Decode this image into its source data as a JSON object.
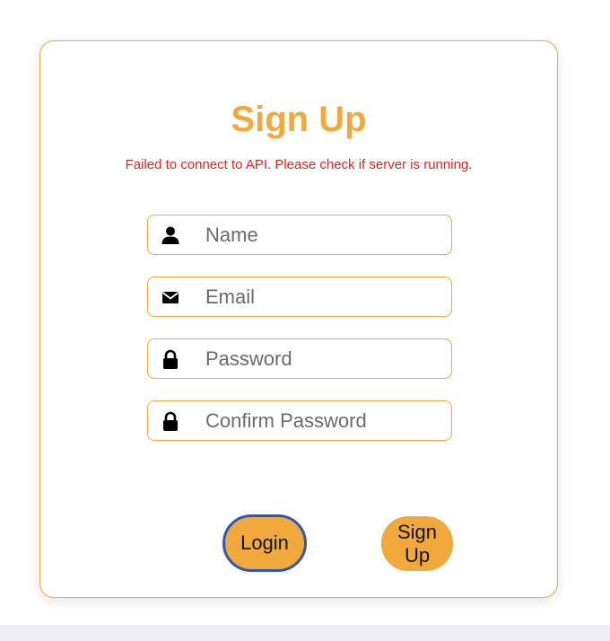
{
  "form": {
    "title": "Sign Up",
    "error_message": "Failed to connect to API. Please check if server is running.",
    "fields": [
      {
        "icon": "user-icon",
        "placeholder": "Name",
        "value": ""
      },
      {
        "icon": "envelope-icon",
        "placeholder": "Email",
        "value": ""
      },
      {
        "icon": "lock-icon",
        "placeholder": "Password",
        "value": ""
      },
      {
        "icon": "lock-icon",
        "placeholder": "Confirm Password",
        "value": ""
      }
    ],
    "buttons": {
      "login_label": "Login",
      "signup_label": "Sign Up"
    }
  },
  "colors": {
    "accent": "#f0a93a",
    "error": "#e0261c",
    "focus_ring": "#2f57b6",
    "page_bottom": "#ededf3"
  }
}
